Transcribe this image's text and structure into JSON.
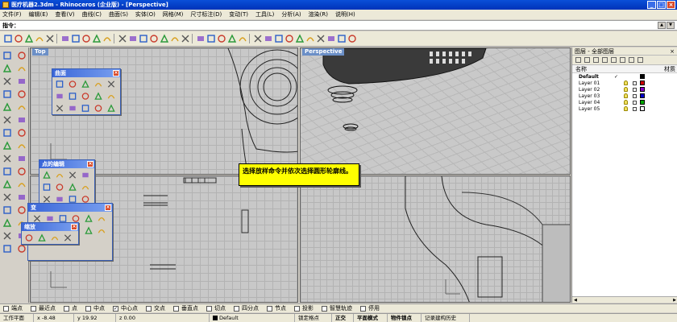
{
  "window": {
    "title": "医疗机器2.3dm - Rhinoceros (企业版) - [Perspective]",
    "buttons": [
      "_",
      "□",
      "×"
    ]
  },
  "menu": [
    "文件(F)",
    "编辑(E)",
    "查看(V)",
    "曲线(C)",
    "曲面(S)",
    "实体(O)",
    "网格(M)",
    "尺寸标注(D)",
    "变动(T)",
    "工具(L)",
    "分析(A)",
    "渲染(R)",
    "说明(H)"
  ],
  "command": {
    "prompt": "指令：",
    "value": ""
  },
  "viewports": {
    "top": "Top",
    "perspective": "Perspective"
  },
  "palettes": {
    "surface": "曲面",
    "point_edit": "点的编辑",
    "transform": "变",
    "scale": "缩放"
  },
  "callout": {
    "text": "选择放样命令并依次选择圆形轮廓线。"
  },
  "layers": {
    "title": "图层 - 全部图层",
    "close": "×",
    "columns": {
      "name": "名称",
      "material": "材质"
    },
    "items": [
      {
        "name": "Default",
        "current": true,
        "color": "#000000"
      },
      {
        "name": "Layer 01",
        "current": false,
        "color": "#cc0000"
      },
      {
        "name": "Layer 02",
        "current": false,
        "color": "#8800cc"
      },
      {
        "name": "Layer 03",
        "current": false,
        "color": "#0000cc"
      },
      {
        "name": "Layer 04",
        "current": false,
        "color": "#00aa00"
      },
      {
        "name": "Layer 05",
        "current": false,
        "color": "#ffffff"
      }
    ]
  },
  "snaps": [
    {
      "label": "端点",
      "checked": false
    },
    {
      "label": "最近点",
      "checked": false
    },
    {
      "label": "点",
      "checked": false
    },
    {
      "label": "中点",
      "checked": false
    },
    {
      "label": "中心点",
      "checked": true
    },
    {
      "label": "交点",
      "checked": false
    },
    {
      "label": "垂直点",
      "checked": false
    },
    {
      "label": "切点",
      "checked": false
    },
    {
      "label": "四分点",
      "checked": false
    },
    {
      "label": "节点",
      "checked": false
    },
    {
      "label": "投影",
      "checked": false
    },
    {
      "label": "智慧轨迹",
      "checked": false
    },
    {
      "label": "停用",
      "checked": false
    }
  ],
  "status": {
    "plane": "工作平面",
    "x": "x -8.48",
    "y": "y 19.92",
    "z": "z 0.00",
    "layer": "Default",
    "lock_grid": "锁定格点",
    "ortho": "正交",
    "planar": "平面模式",
    "osnap": "物件锁点",
    "history": "记录建构历史"
  },
  "icons": {
    "toolbar": [
      "new-icon",
      "open-icon",
      "save-icon",
      "print-icon",
      "import-icon",
      "cut-icon",
      "copy-icon",
      "paste-icon",
      "undo-icon",
      "redo-icon",
      "pan-icon",
      "rotate-view-icon",
      "zoom-icon",
      "zoom-window-icon",
      "zoom-extents-icon",
      "zoom-selected-icon",
      "hide-icon",
      "four-view-icon",
      "grid-icon",
      "car-icon",
      "mirror-icon",
      "set-cplane-icon",
      "light-icon",
      "surface-icon",
      "shaded-icon",
      "render-icon",
      "material-icon",
      "environment-icon",
      "sphere-icon",
      "osnap-tool-icon",
      "gear-icon",
      "help-icon"
    ],
    "lefttools": [
      "select-arrow-icon",
      "point-icon",
      "polyline-icon",
      "line-icon",
      "circle-icon",
      "arc-icon",
      "ellipse-icon",
      "curve-icon",
      "rectangle-icon",
      "polygon-icon",
      "offset-icon",
      "fillet-icon",
      "surface-patch-icon",
      "loft-icon",
      "box-icon",
      "extrude-icon",
      "boolean-icon",
      "explode-icon",
      "join-icon",
      "trim-icon",
      "split-icon",
      "move-icon",
      "copy-tool-icon",
      "rotate-icon",
      "array-icon",
      "scale-tool-icon",
      "mirror-tool-icon",
      "dimension-icon",
      "text-icon",
      "analyze-icon",
      "layer-tool-icon",
      "render-tool-icon"
    ]
  },
  "colors": {
    "titlebar": "#0a4fd8",
    "viewport_label": "#6b8fc7",
    "callout": "#ffff00",
    "grid_bg": "#c8c8c8"
  }
}
